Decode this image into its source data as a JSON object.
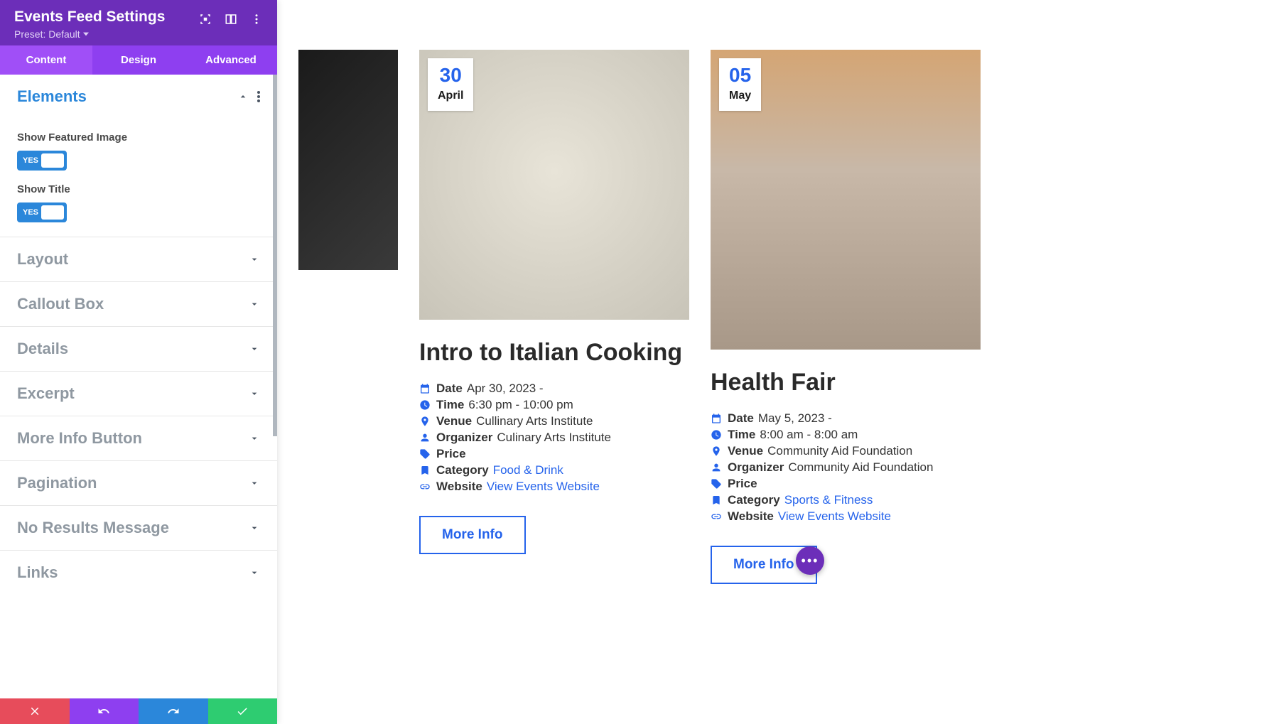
{
  "header": {
    "title": "Events Feed Settings",
    "preset_label": "Preset: Default"
  },
  "tabs": [
    "Content",
    "Design",
    "Advanced"
  ],
  "elements": {
    "title": "Elements",
    "show_featured_image_label": "Show Featured Image",
    "show_featured_image_value": "YES",
    "show_title_label": "Show Title",
    "show_title_value": "YES"
  },
  "sections": [
    "Layout",
    "Callout Box",
    "Details",
    "Excerpt",
    "More Info Button",
    "Pagination",
    "No Results Message",
    "Links"
  ],
  "cards": [
    {
      "day": "30",
      "month": "April",
      "title": "Intro to Italian Cooking",
      "date_label": "Date",
      "date_value": "Apr 30, 2023 -",
      "time_label": "Time",
      "time_value": "6:30 pm - 10:00 pm",
      "venue_label": "Venue",
      "venue_value": "Cullinary Arts Institute",
      "organizer_label": "Organizer",
      "organizer_value": "Culinary Arts Institute",
      "price_label": "Price",
      "category_label": "Category",
      "category_value": "Food & Drink",
      "website_label": "Website",
      "website_value": "View Events Website",
      "more_info": "More Info"
    },
    {
      "day": "05",
      "month": "May",
      "title": "Health Fair",
      "date_label": "Date",
      "date_value": "May 5, 2023 -",
      "time_label": "Time",
      "time_value": "8:00 am - 8:00 am",
      "venue_label": "Venue",
      "venue_value": "Community Aid Foundation",
      "organizer_label": "Organizer",
      "organizer_value": "Community Aid Foundation",
      "price_label": "Price",
      "category_label": "Category",
      "category_value": "Sports & Fitness",
      "website_label": "Website",
      "website_value": "View Events Website",
      "more_info": "More Info"
    }
  ]
}
